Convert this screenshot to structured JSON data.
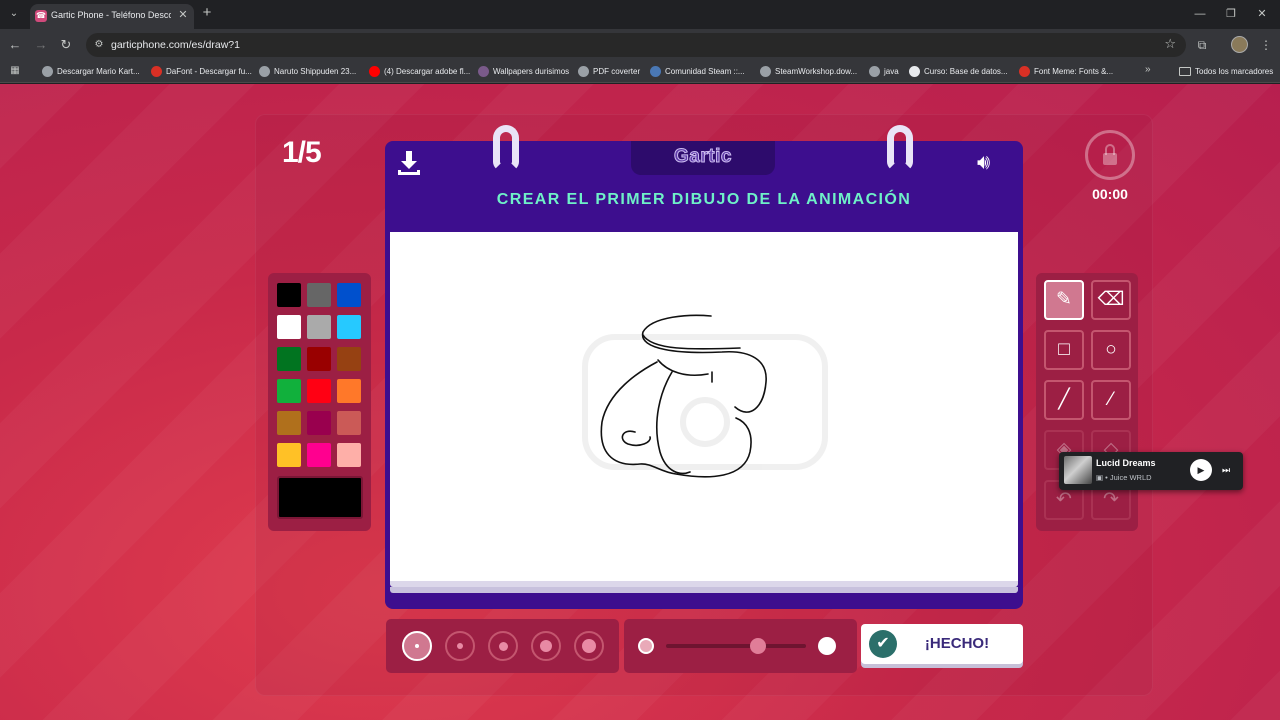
{
  "browser": {
    "tab_title": "Gartic Phone - Teléfono Descomp",
    "tab_search_icon": "chevron-down-icon",
    "new_tab_icon": "plus-icon",
    "url": "garticphone.com/es/draw?1",
    "bookmarks": [
      {
        "label": "Descargar Mario Kart...",
        "icon_color": "#9aa0a6"
      },
      {
        "label": "DaFont - Descargar fu...",
        "icon_color": "#d93025"
      },
      {
        "label": "Naruto Shippuden 23...",
        "icon_color": "#9aa0a6"
      },
      {
        "label": "(4) Descargar adobe fl...",
        "icon_color": "#ff0000"
      },
      {
        "label": "Wallpapers durisimos",
        "icon_color": "#7a5a8a"
      },
      {
        "label": "PDF coverter",
        "icon_color": "#9aa0a6"
      },
      {
        "label": "Comunidad Steam ::...",
        "icon_color": "#4a78b5"
      },
      {
        "label": "SteamWorkshop.dow...",
        "icon_color": "#9aa0a6"
      },
      {
        "label": "java",
        "icon_color": "#9aa0a6"
      },
      {
        "label": "Curso: Base de datos...",
        "icon_color": "#e8eaed"
      },
      {
        "label": "Font Meme: Fonts &...",
        "icon_color": "#d93025"
      }
    ],
    "bookmarks_more": "»",
    "all_bookmarks": "Todos los marcadores"
  },
  "game": {
    "round": "1/5",
    "logo": "Gartic",
    "prompt": "CREAR EL PRIMER DIBUJO DE LA ANIMACIÓN",
    "timer": "00:00",
    "done_label": "¡HECHO!",
    "palette": [
      "#000000",
      "#666666",
      "#0050cd",
      "#ffffff",
      "#aaaaaa",
      "#26c9ff",
      "#017420",
      "#990000",
      "#964112",
      "#11b03c",
      "#ff0013",
      "#ff7829",
      "#b0701c",
      "#99004e",
      "#cb5a57",
      "#ffc126",
      "#ff008f",
      "#feafa8"
    ],
    "current_color": "#000000",
    "tools": [
      {
        "name": "pencil",
        "icon": "✎",
        "active": true
      },
      {
        "name": "eraser",
        "icon": "⌫",
        "active": false
      },
      {
        "name": "rectangle",
        "icon": "□",
        "active": false
      },
      {
        "name": "ellipse",
        "icon": "○",
        "active": false
      },
      {
        "name": "line",
        "icon": "╱",
        "active": false
      },
      {
        "name": "eyedropper",
        "icon": "⁄",
        "active": false
      },
      {
        "name": "fill",
        "icon": "◈",
        "active": false
      },
      {
        "name": "fill-pattern",
        "icon": "◇",
        "active": false
      },
      {
        "name": "undo",
        "icon": "↶",
        "active": false
      },
      {
        "name": "redo",
        "icon": "↷",
        "active": false
      }
    ],
    "brush_sizes": [
      1,
      2,
      3,
      4,
      5
    ],
    "selected_brush_size": 1,
    "opacity_level": 0.66
  },
  "media": {
    "title": "Lucid Dreams",
    "artist": "Juice WRLD"
  }
}
